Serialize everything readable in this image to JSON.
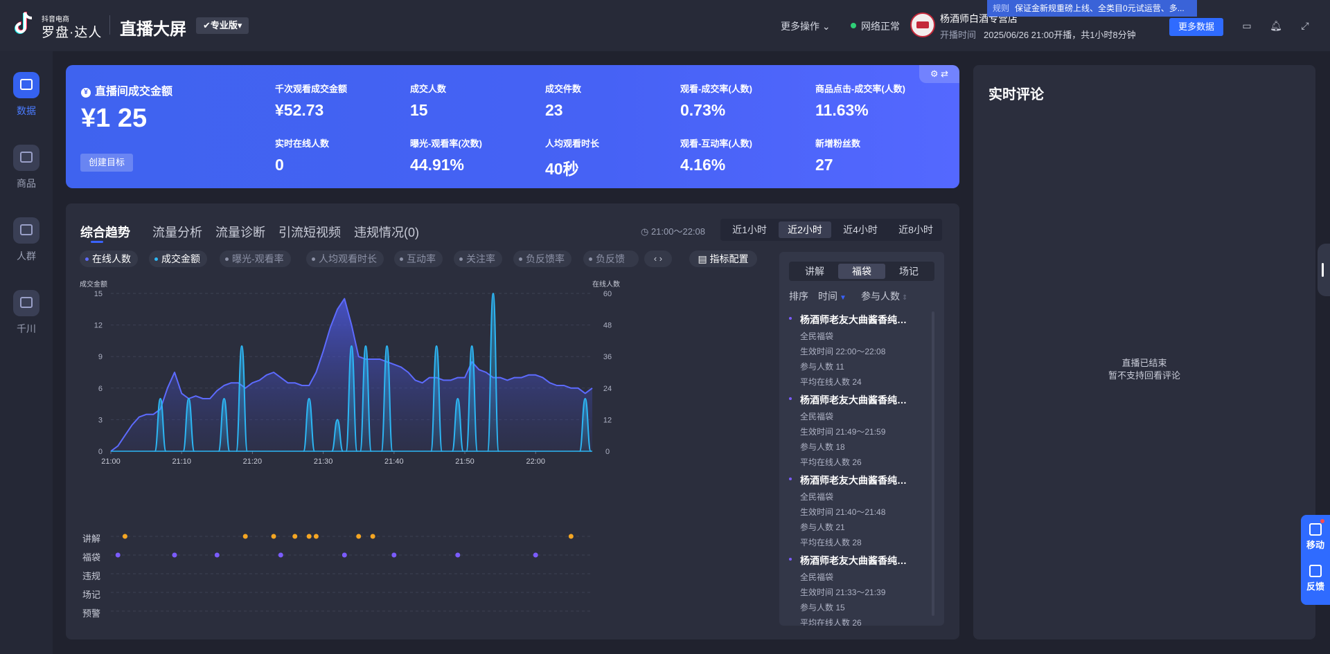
{
  "header": {
    "logo_small": "抖音电商",
    "logo_big": "罗盘·达人",
    "page_title": "直播大屏",
    "pro_badge": "✔专业版▾",
    "more_ops": "更多操作 ⌄",
    "net_status": "网络正常",
    "shop_name": "杨酒师白酒专营店",
    "live_time_label": "开播时间",
    "live_time_value": "2025/06/26 21:00开播，共1小时8分钟",
    "notice_tag": "规则",
    "notice_text": "保证金新规重磅上线、全类目0元试运营、多...",
    "more_data_btn": "更多数据"
  },
  "nav": {
    "items": [
      {
        "label": "数据",
        "icon": "chart-trend-icon",
        "active": true
      },
      {
        "label": "商品",
        "icon": "shopping-cart-icon",
        "active": false
      },
      {
        "label": "人群",
        "icon": "people-icon",
        "active": false
      },
      {
        "label": "千川",
        "icon": "broadcast-icon",
        "active": false
      }
    ]
  },
  "kpi": {
    "main_label": "直播间成交金额",
    "main_currency": "¥",
    "main_value": "¥1 25",
    "target_btn": "创建目标",
    "items": [
      {
        "label": "千次观看成交金额",
        "value": "¥52.73"
      },
      {
        "label": "成交人数",
        "value": "15"
      },
      {
        "label": "成交件数",
        "value": "23"
      },
      {
        "label": "观看-成交率(人数)",
        "value": "0.73%"
      },
      {
        "label": "商品点击-成交率(人数)",
        "value": "11.63%"
      },
      {
        "label": "实时在线人数",
        "value": "0"
      },
      {
        "label": "曝光-观看率(次数)",
        "value": "44.91%"
      },
      {
        "label": "人均观看时长",
        "value": "40秒"
      },
      {
        "label": "观看-互动率(人数)",
        "value": "4.16%"
      },
      {
        "label": "新增粉丝数",
        "value": "27"
      }
    ],
    "tools": "⚙ ⇄"
  },
  "trend": {
    "tabs": [
      "综合趋势",
      "流量分析",
      "流量诊断",
      "引流短视频",
      "违规情况(0)"
    ],
    "time_range": "◷ 21:00～22:08",
    "periods": [
      "近1小时",
      "近2小时",
      "近4小时",
      "近8小时"
    ],
    "active_period": 1,
    "metric_chips": [
      "在线人数",
      "成交金额",
      "曝光-观看率",
      "人均观看时长",
      "互动率",
      "关注率",
      "负反馈率",
      "负反馈"
    ],
    "chip_arrows": "‹ ›",
    "metric_config": "▤ 指标配置",
    "event_rows": [
      "讲解",
      "福袋",
      "违规",
      "场记",
      "预警"
    ]
  },
  "chart_data": {
    "type": "area",
    "left_axis_label": "成交金额",
    "right_axis_label": "在线人数",
    "x_ticks": [
      "21:00",
      "21:10",
      "21:20",
      "21:30",
      "21:40",
      "21:50",
      "22:00"
    ],
    "y_left_ticks": [
      0,
      3,
      6,
      9,
      12,
      15
    ],
    "y_right_ticks": [
      0,
      12,
      24,
      36,
      48,
      60
    ],
    "ylim_left": [
      0,
      15
    ],
    "ylim_right": [
      0,
      60
    ],
    "x_minutes_range": [
      0,
      68
    ],
    "series": [
      {
        "name": "在线人数",
        "axis": "right",
        "color": "#5d6bff",
        "points": [
          [
            0,
            0
          ],
          [
            1,
            2
          ],
          [
            2,
            6
          ],
          [
            3,
            10
          ],
          [
            4,
            13
          ],
          [
            5,
            14
          ],
          [
            6,
            14
          ],
          [
            7,
            16
          ],
          [
            8,
            24
          ],
          [
            9,
            30
          ],
          [
            10,
            22
          ],
          [
            11,
            20
          ],
          [
            12,
            21
          ],
          [
            13,
            20
          ],
          [
            14,
            20
          ],
          [
            15,
            23
          ],
          [
            16,
            25
          ],
          [
            17,
            26
          ],
          [
            18,
            26
          ],
          [
            19,
            24
          ],
          [
            20,
            26
          ],
          [
            21,
            27
          ],
          [
            22,
            29
          ],
          [
            23,
            30
          ],
          [
            24,
            28
          ],
          [
            25,
            26
          ],
          [
            26,
            26
          ],
          [
            27,
            25
          ],
          [
            28,
            25
          ],
          [
            29,
            30
          ],
          [
            30,
            38
          ],
          [
            31,
            47
          ],
          [
            32,
            54
          ],
          [
            33,
            58
          ],
          [
            34,
            48
          ],
          [
            35,
            36
          ],
          [
            36,
            35
          ],
          [
            37,
            35
          ],
          [
            38,
            35
          ],
          [
            39,
            34
          ],
          [
            40,
            33
          ],
          [
            41,
            32
          ],
          [
            42,
            30
          ],
          [
            43,
            27
          ],
          [
            44,
            26
          ],
          [
            45,
            28
          ],
          [
            46,
            28
          ],
          [
            47,
            27
          ],
          [
            48,
            27
          ],
          [
            49,
            28
          ],
          [
            50,
            28
          ],
          [
            51,
            34
          ],
          [
            52,
            31
          ],
          [
            53,
            30
          ],
          [
            54,
            28
          ],
          [
            55,
            28
          ],
          [
            56,
            27
          ],
          [
            57,
            28
          ],
          [
            58,
            28
          ],
          [
            59,
            29
          ],
          [
            60,
            29
          ],
          [
            61,
            28
          ],
          [
            62,
            26
          ],
          [
            63,
            25
          ],
          [
            64,
            25
          ],
          [
            65,
            24
          ],
          [
            66,
            24
          ],
          [
            67,
            22
          ],
          [
            68,
            24
          ]
        ]
      },
      {
        "name": "成交金额",
        "axis": "left",
        "color": "#2db7f5",
        "peaks": [
          [
            7,
            5
          ],
          [
            11,
            5
          ],
          [
            16,
            5
          ],
          [
            18.5,
            10
          ],
          [
            28,
            5
          ],
          [
            32,
            3
          ],
          [
            34,
            10
          ],
          [
            36,
            10
          ],
          [
            39,
            10
          ],
          [
            46,
            10
          ],
          [
            49,
            5
          ],
          [
            51,
            10
          ],
          [
            54,
            15
          ],
          [
            67,
            5
          ]
        ]
      }
    ]
  },
  "events": {
    "讲解": {
      "color": "#f5a623",
      "minutes": [
        2,
        19,
        23,
        26,
        28,
        29,
        35,
        37,
        65
      ]
    },
    "福袋": {
      "color": "#7b5cff",
      "minutes": [
        1,
        9,
        15,
        24,
        33,
        40,
        49,
        60
      ]
    }
  },
  "side_list": {
    "tabs": [
      "讲解",
      "福袋",
      "场记"
    ],
    "active_tab": 1,
    "sort_label": "排序",
    "sort_time": "时间",
    "sort_people": "参与人数",
    "items": [
      {
        "title": "杨酒师老友大曲酱香纯粮酒",
        "type": "全民福袋",
        "time": "生效时间 22:00～22:08",
        "count": "参与人数 11",
        "avg": "平均在线人数 24"
      },
      {
        "title": "杨酒师老友大曲酱香纯粮酒",
        "type": "全民福袋",
        "time": "生效时间 21:49～21:59",
        "count": "参与人数 18",
        "avg": "平均在线人数 26"
      },
      {
        "title": "杨酒师老友大曲酱香纯粮酒",
        "type": "全民福袋",
        "time": "生效时间 21:40～21:48",
        "count": "参与人数 21",
        "avg": "平均在线人数 28"
      },
      {
        "title": "杨酒师老友大曲酱香纯粮酒",
        "type": "全民福袋",
        "time": "生效时间 21:33～21:39",
        "count": "参与人数 15",
        "avg": "平均在线人数 26"
      }
    ]
  },
  "comments": {
    "title": "实时评论",
    "empty_line1": "直播已结束",
    "empty_line2": "暂不支持回看评论"
  },
  "float": {
    "move": "移动",
    "feedback": "反馈"
  }
}
